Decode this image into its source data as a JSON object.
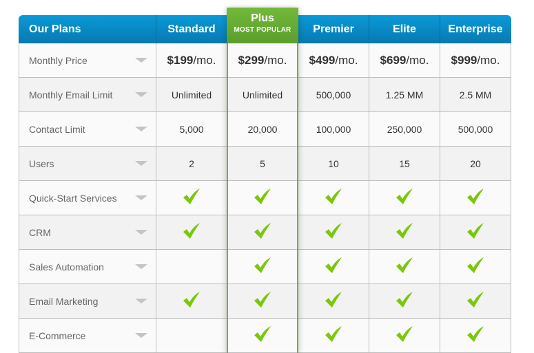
{
  "header": {
    "title": "Our Plans",
    "plans": [
      {
        "name": "Standard"
      },
      {
        "name": "Plus",
        "badge": "MOST POPULAR"
      },
      {
        "name": "Premier"
      },
      {
        "name": "Elite"
      },
      {
        "name": "Enterprise"
      }
    ]
  },
  "colors": {
    "header_blue": "#0a8fcc",
    "highlight_green": "#6cb33f",
    "check_green": "#7ac70c"
  },
  "rows": [
    {
      "label": "Monthly Price",
      "type": "price",
      "values": [
        {
          "amount": "$199",
          "unit": "/mo."
        },
        {
          "amount": "$299",
          "unit": "/mo."
        },
        {
          "amount": "$499",
          "unit": "/mo."
        },
        {
          "amount": "$699",
          "unit": "/mo."
        },
        {
          "amount": "$999",
          "unit": "/mo."
        }
      ]
    },
    {
      "label": "Monthly Email Limit",
      "type": "text",
      "values": [
        "Unlimited",
        "Unlimited",
        "500,000",
        "1.25 MM",
        "2.5 MM"
      ]
    },
    {
      "label": "Contact Limit",
      "type": "text",
      "values": [
        "5,000",
        "20,000",
        "100,000",
        "250,000",
        "500,000"
      ]
    },
    {
      "label": "Users",
      "type": "text",
      "values": [
        "2",
        "5",
        "10",
        "15",
        "20"
      ]
    },
    {
      "label": "Quick-Start Services",
      "type": "check",
      "values": [
        true,
        true,
        true,
        true,
        true
      ]
    },
    {
      "label": "CRM",
      "type": "check",
      "values": [
        true,
        true,
        true,
        true,
        true
      ]
    },
    {
      "label": "Sales Automation",
      "type": "check",
      "values": [
        false,
        true,
        true,
        true,
        true
      ]
    },
    {
      "label": "Email Marketing",
      "type": "check",
      "values": [
        true,
        true,
        true,
        true,
        true
      ]
    },
    {
      "label": "E-Commerce",
      "type": "check",
      "values": [
        false,
        true,
        true,
        true,
        true
      ]
    }
  ]
}
